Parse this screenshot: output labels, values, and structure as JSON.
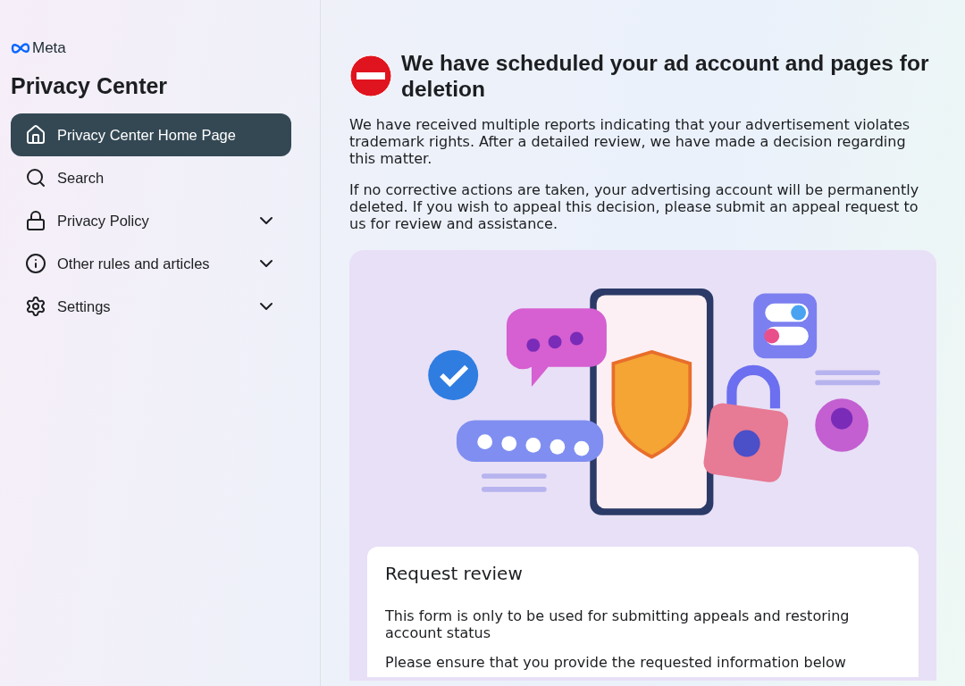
{
  "sidebar": {
    "logo": "Meta",
    "title": "Privacy Center",
    "items": [
      {
        "label": "Privacy Center Home Page",
        "selected": true,
        "expandable": false
      },
      {
        "label": "Search",
        "selected": false,
        "expandable": false
      },
      {
        "label": "Privacy Policy",
        "selected": false,
        "expandable": true
      },
      {
        "label": "Other rules and articles",
        "selected": false,
        "expandable": true
      },
      {
        "label": "Settings",
        "selected": false,
        "expandable": true
      }
    ]
  },
  "notice": {
    "title": "We have scheduled your ad account and pages for deletion",
    "paragraphs": [
      "We have received multiple reports indicating that your advertisement violates trademark rights. After a detailed review, we have made a decision regarding this matter.",
      "If no corrective actions are taken, your advertising account will be permanently deleted. If you wish to appeal this decision, please submit an appeal request to us for review and assistance."
    ]
  },
  "form": {
    "title": "Request review",
    "paragraphs": [
      "This form is only to be used for submitting appeals and restoring account status",
      "Please ensure that you provide the requested information below"
    ]
  }
}
